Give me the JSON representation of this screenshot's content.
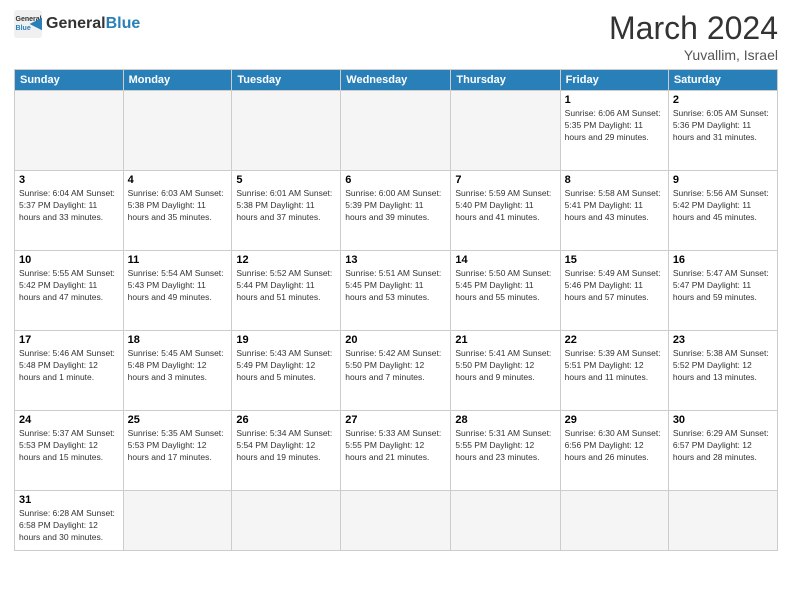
{
  "header": {
    "logo_general": "General",
    "logo_blue": "Blue",
    "month_year": "March 2024",
    "location": "Yuvallim, Israel"
  },
  "weekdays": [
    "Sunday",
    "Monday",
    "Tuesday",
    "Wednesday",
    "Thursday",
    "Friday",
    "Saturday"
  ],
  "weeks": [
    [
      {
        "day": "",
        "info": ""
      },
      {
        "day": "",
        "info": ""
      },
      {
        "day": "",
        "info": ""
      },
      {
        "day": "",
        "info": ""
      },
      {
        "day": "",
        "info": ""
      },
      {
        "day": "1",
        "info": "Sunrise: 6:06 AM\nSunset: 5:35 PM\nDaylight: 11 hours\nand 29 minutes."
      },
      {
        "day": "2",
        "info": "Sunrise: 6:05 AM\nSunset: 5:36 PM\nDaylight: 11 hours\nand 31 minutes."
      }
    ],
    [
      {
        "day": "3",
        "info": "Sunrise: 6:04 AM\nSunset: 5:37 PM\nDaylight: 11 hours\nand 33 minutes."
      },
      {
        "day": "4",
        "info": "Sunrise: 6:03 AM\nSunset: 5:38 PM\nDaylight: 11 hours\nand 35 minutes."
      },
      {
        "day": "5",
        "info": "Sunrise: 6:01 AM\nSunset: 5:38 PM\nDaylight: 11 hours\nand 37 minutes."
      },
      {
        "day": "6",
        "info": "Sunrise: 6:00 AM\nSunset: 5:39 PM\nDaylight: 11 hours\nand 39 minutes."
      },
      {
        "day": "7",
        "info": "Sunrise: 5:59 AM\nSunset: 5:40 PM\nDaylight: 11 hours\nand 41 minutes."
      },
      {
        "day": "8",
        "info": "Sunrise: 5:58 AM\nSunset: 5:41 PM\nDaylight: 11 hours\nand 43 minutes."
      },
      {
        "day": "9",
        "info": "Sunrise: 5:56 AM\nSunset: 5:42 PM\nDaylight: 11 hours\nand 45 minutes."
      }
    ],
    [
      {
        "day": "10",
        "info": "Sunrise: 5:55 AM\nSunset: 5:42 PM\nDaylight: 11 hours\nand 47 minutes."
      },
      {
        "day": "11",
        "info": "Sunrise: 5:54 AM\nSunset: 5:43 PM\nDaylight: 11 hours\nand 49 minutes."
      },
      {
        "day": "12",
        "info": "Sunrise: 5:52 AM\nSunset: 5:44 PM\nDaylight: 11 hours\nand 51 minutes."
      },
      {
        "day": "13",
        "info": "Sunrise: 5:51 AM\nSunset: 5:45 PM\nDaylight: 11 hours\nand 53 minutes."
      },
      {
        "day": "14",
        "info": "Sunrise: 5:50 AM\nSunset: 5:45 PM\nDaylight: 11 hours\nand 55 minutes."
      },
      {
        "day": "15",
        "info": "Sunrise: 5:49 AM\nSunset: 5:46 PM\nDaylight: 11 hours\nand 57 minutes."
      },
      {
        "day": "16",
        "info": "Sunrise: 5:47 AM\nSunset: 5:47 PM\nDaylight: 11 hours\nand 59 minutes."
      }
    ],
    [
      {
        "day": "17",
        "info": "Sunrise: 5:46 AM\nSunset: 5:48 PM\nDaylight: 12 hours\nand 1 minute."
      },
      {
        "day": "18",
        "info": "Sunrise: 5:45 AM\nSunset: 5:48 PM\nDaylight: 12 hours\nand 3 minutes."
      },
      {
        "day": "19",
        "info": "Sunrise: 5:43 AM\nSunset: 5:49 PM\nDaylight: 12 hours\nand 5 minutes."
      },
      {
        "day": "20",
        "info": "Sunrise: 5:42 AM\nSunset: 5:50 PM\nDaylight: 12 hours\nand 7 minutes."
      },
      {
        "day": "21",
        "info": "Sunrise: 5:41 AM\nSunset: 5:50 PM\nDaylight: 12 hours\nand 9 minutes."
      },
      {
        "day": "22",
        "info": "Sunrise: 5:39 AM\nSunset: 5:51 PM\nDaylight: 12 hours\nand 11 minutes."
      },
      {
        "day": "23",
        "info": "Sunrise: 5:38 AM\nSunset: 5:52 PM\nDaylight: 12 hours\nand 13 minutes."
      }
    ],
    [
      {
        "day": "24",
        "info": "Sunrise: 5:37 AM\nSunset: 5:53 PM\nDaylight: 12 hours\nand 15 minutes."
      },
      {
        "day": "25",
        "info": "Sunrise: 5:35 AM\nSunset: 5:53 PM\nDaylight: 12 hours\nand 17 minutes."
      },
      {
        "day": "26",
        "info": "Sunrise: 5:34 AM\nSunset: 5:54 PM\nDaylight: 12 hours\nand 19 minutes."
      },
      {
        "day": "27",
        "info": "Sunrise: 5:33 AM\nSunset: 5:55 PM\nDaylight: 12 hours\nand 21 minutes."
      },
      {
        "day": "28",
        "info": "Sunrise: 5:31 AM\nSunset: 5:55 PM\nDaylight: 12 hours\nand 23 minutes."
      },
      {
        "day": "29",
        "info": "Sunrise: 6:30 AM\nSunset: 6:56 PM\nDaylight: 12 hours\nand 26 minutes."
      },
      {
        "day": "30",
        "info": "Sunrise: 6:29 AM\nSunset: 6:57 PM\nDaylight: 12 hours\nand 28 minutes."
      }
    ],
    [
      {
        "day": "31",
        "info": "Sunrise: 6:28 AM\nSunset: 6:58 PM\nDaylight: 12 hours\nand 30 minutes."
      },
      {
        "day": "",
        "info": ""
      },
      {
        "day": "",
        "info": ""
      },
      {
        "day": "",
        "info": ""
      },
      {
        "day": "",
        "info": ""
      },
      {
        "day": "",
        "info": ""
      },
      {
        "day": "",
        "info": ""
      }
    ]
  ]
}
